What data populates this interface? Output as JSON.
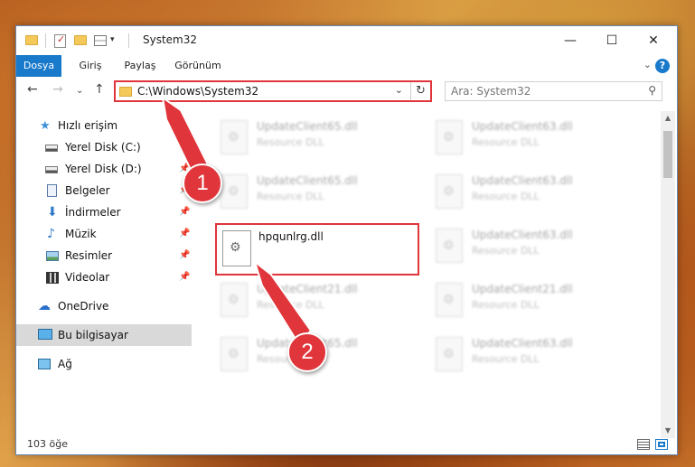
{
  "window": {
    "title": "System32",
    "minimize": "—",
    "maximize": "☐",
    "close": "✕"
  },
  "quick_access_toolbar": {
    "dropdown": "▾"
  },
  "ribbon": {
    "tabs": [
      {
        "label": "Dosya",
        "active": true
      },
      {
        "label": "Giriş"
      },
      {
        "label": "Paylaş"
      },
      {
        "label": "Görünüm"
      }
    ],
    "collapse": "⌄",
    "help": "?"
  },
  "nav": {
    "back": "←",
    "forward": "→",
    "recent": "⌄",
    "up": "↑",
    "address": "C:\\Windows\\System32",
    "address_dropdown": "⌄",
    "refresh": "↻",
    "search_placeholder": "Ara: System32",
    "search_icon": "⚲"
  },
  "sidebar": {
    "items": [
      {
        "label": "Hızlı erişim",
        "icon": "star-icon"
      },
      {
        "label": "Yerel Disk (C:)",
        "icon": "disk-icon",
        "pinned": true
      },
      {
        "label": "Yerel Disk (D:)",
        "icon": "disk-icon",
        "pinned": true
      },
      {
        "label": "Belgeler",
        "icon": "document-icon",
        "pinned": true
      },
      {
        "label": "İndirmeler",
        "icon": "download-icon",
        "pinned": true
      },
      {
        "label": "Müzik",
        "icon": "music-icon",
        "pinned": true
      },
      {
        "label": "Resimler",
        "icon": "pictures-icon",
        "pinned": true
      },
      {
        "label": "Videolar",
        "icon": "video-icon",
        "pinned": true
      },
      {
        "label": "OneDrive",
        "icon": "cloud-icon"
      },
      {
        "label": "Bu bilgisayar",
        "icon": "computer-icon",
        "selected": true
      },
      {
        "label": "Ağ",
        "icon": "network-icon"
      }
    ],
    "pin_glyph": "📌"
  },
  "files": {
    "col1": [
      {
        "name": "UpdateClient65.dll",
        "type": "Resource DLL"
      },
      {
        "name": "UpdateClient65.dll",
        "type": "Resource DLL"
      },
      {
        "name": "hpqunlrg.dll",
        "type": "",
        "highlighted": true
      },
      {
        "name": "UpdateClient21.dll",
        "type": "Resource DLL"
      },
      {
        "name": "UpdateClient65.dll",
        "type": "Resource DLL"
      }
    ],
    "col2": [
      {
        "name": "UpdateClient63.dll",
        "type": "Resource DLL"
      },
      {
        "name": "UpdateClient63.dll",
        "type": "Resource DLL"
      },
      {
        "name": "UpdateClient63.dll",
        "type": "Resource DLL"
      },
      {
        "name": "UpdateClient21.dll",
        "type": "Resource DLL"
      },
      {
        "name": "UpdateClient63.dll",
        "type": "Resource DLL"
      }
    ]
  },
  "status": {
    "item_count": "103 öğe"
  },
  "annotations": {
    "step1": "1",
    "step2": "2"
  },
  "colors": {
    "accent": "#1979ca",
    "highlight": "#e0353a"
  }
}
